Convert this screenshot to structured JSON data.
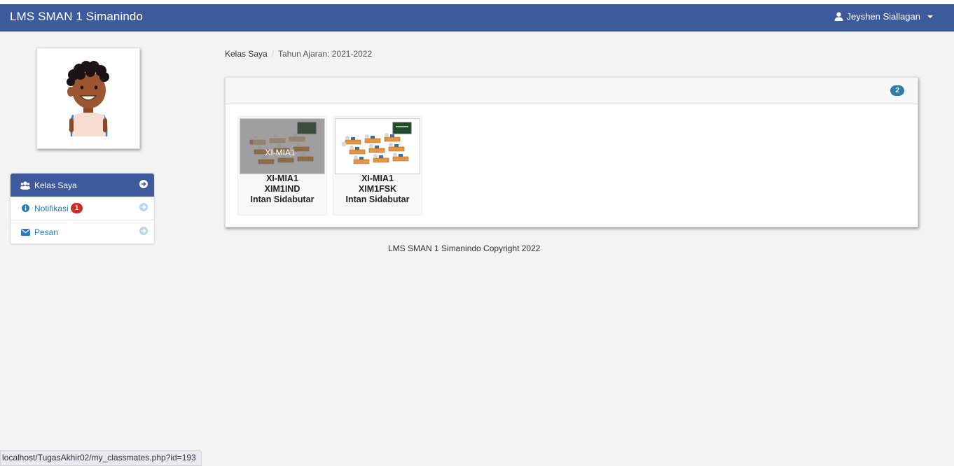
{
  "navbar": {
    "brand": "LMS SMAN 1 Simanindo",
    "user_name": "Jeyshen Siallagan"
  },
  "sidebar": {
    "items": [
      {
        "label": "Kelas Saya",
        "icon": "users-icon",
        "active": true
      },
      {
        "label": "Notifikasi",
        "icon": "info-circle-icon",
        "badge": "1"
      },
      {
        "label": "Pesan",
        "icon": "envelope-icon"
      }
    ]
  },
  "breadcrumb": {
    "items": [
      "Kelas Saya",
      "Tahun Ajaran: 2021-2022"
    ]
  },
  "panel": {
    "count": "2",
    "classes": [
      {
        "overlay": "XI-MIA1",
        "class_name": "XI-MIA1",
        "code": "XIM1IND",
        "teacher": "Intan Sidabutar",
        "hovered": true
      },
      {
        "overlay": "",
        "class_name": "XI-MIA1",
        "code": "XIM1FSK",
        "teacher": "Intan Sidabutar",
        "hovered": false
      }
    ]
  },
  "footer": "LMS SMAN 1 Simanindo Copyright 2022",
  "statusbar": "localhost/TugasAkhir02/my_classmates.php?id=193",
  "colors": {
    "navbar": "#3c5a9c",
    "badge_red": "#c9302c",
    "badge_blue": "#317ca9",
    "link": "#2a7ab8"
  }
}
